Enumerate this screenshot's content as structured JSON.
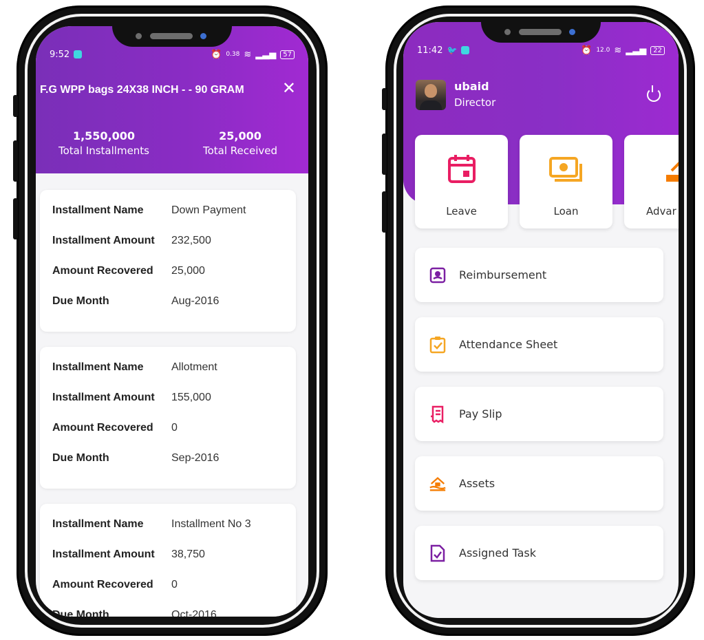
{
  "left_phone": {
    "status": {
      "time": "9:52",
      "net_speed": "0.38",
      "battery": "57"
    },
    "title": "F.G WPP bags 24X38 INCH - - 90 GRAM",
    "stats": [
      {
        "value": "1,550,000",
        "label": "Total Installments"
      },
      {
        "value": "25,000",
        "label": "Total Received"
      }
    ],
    "installments": [
      {
        "name_label": "Installment Name",
        "name": "Down Payment",
        "amount_label": "Installment Amount",
        "amount": "232,500",
        "recovered_label": "Amount Recovered",
        "recovered": "25,000",
        "due_label": "Due Month",
        "due": "Aug-2016"
      },
      {
        "name_label": "Installment Name",
        "name": "Allotment",
        "amount_label": "Installment Amount",
        "amount": "155,000",
        "recovered_label": "Amount Recovered",
        "recovered": "0",
        "due_label": "Due Month",
        "due": "Sep-2016"
      },
      {
        "name_label": "Installment Name",
        "name": "Installment No 3",
        "amount_label": "Installment Amount",
        "amount": "38,750",
        "recovered_label": "Amount Recovered",
        "recovered": "0",
        "due_label": "Due Month",
        "due": "Oct-2016"
      }
    ]
  },
  "right_phone": {
    "status": {
      "time": "11:42",
      "net_speed": "12.0",
      "battery": "22"
    },
    "user": {
      "name": "ubaid",
      "role": "Director"
    },
    "tiles": [
      {
        "label": "Leave",
        "icon": "calendar-icon",
        "color": "#e91e63"
      },
      {
        "label": "Loan",
        "icon": "cash-icon",
        "color": "#f5a623"
      },
      {
        "label": "Advar",
        "icon": "advance-icon",
        "color": "#f57c00"
      }
    ],
    "menu": [
      {
        "label": "Reimbursement",
        "icon": "reimbursement-icon",
        "color": "#7b1fa2"
      },
      {
        "label": "Attendance Sheet",
        "icon": "clipboard-check-icon",
        "color": "#f5a623"
      },
      {
        "label": "Pay Slip",
        "icon": "receipt-icon",
        "color": "#e91e63"
      },
      {
        "label": "Assets",
        "icon": "house-icon",
        "color": "#f57c00"
      },
      {
        "label": "Assigned Task",
        "icon": "task-icon",
        "color": "#7b1fa2"
      }
    ]
  }
}
